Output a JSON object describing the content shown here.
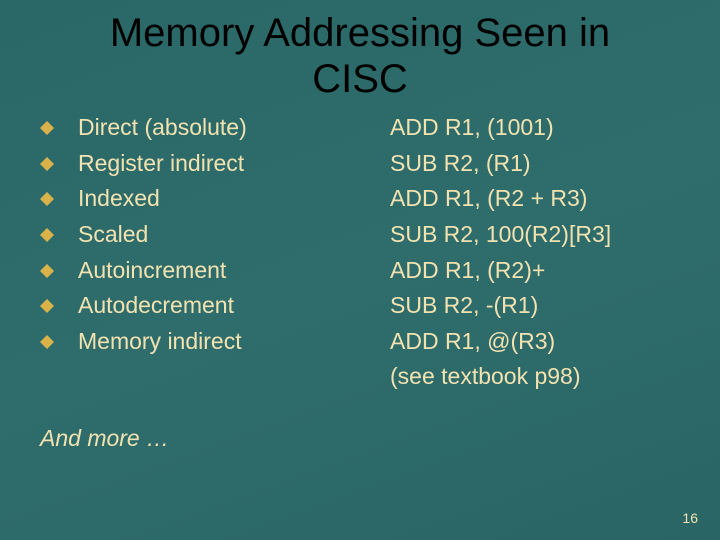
{
  "title_line1": "Memory Addressing Seen in",
  "title_line2": "CISC",
  "items": [
    {
      "name": "Direct (absolute)",
      "example": "ADD R1, (1001)"
    },
    {
      "name": "Register indirect",
      "example": "SUB R2, (R1)"
    },
    {
      "name": "Indexed",
      "example": "ADD R1, (R2 + R3)"
    },
    {
      "name": "Scaled",
      "example": "SUB R2, 100(R2)[R3]"
    },
    {
      "name": "Autoincrement",
      "example": "ADD R1, (R2)+"
    },
    {
      "name": "Autodecrement",
      "example": "SUB R2, -(R1)"
    },
    {
      "name": "Memory indirect",
      "example": "ADD R1, @(R3)"
    }
  ],
  "extra_right": "(see textbook p98)",
  "more_text": "And more …",
  "page_number": "16",
  "bullet_color": "#d9b24a"
}
